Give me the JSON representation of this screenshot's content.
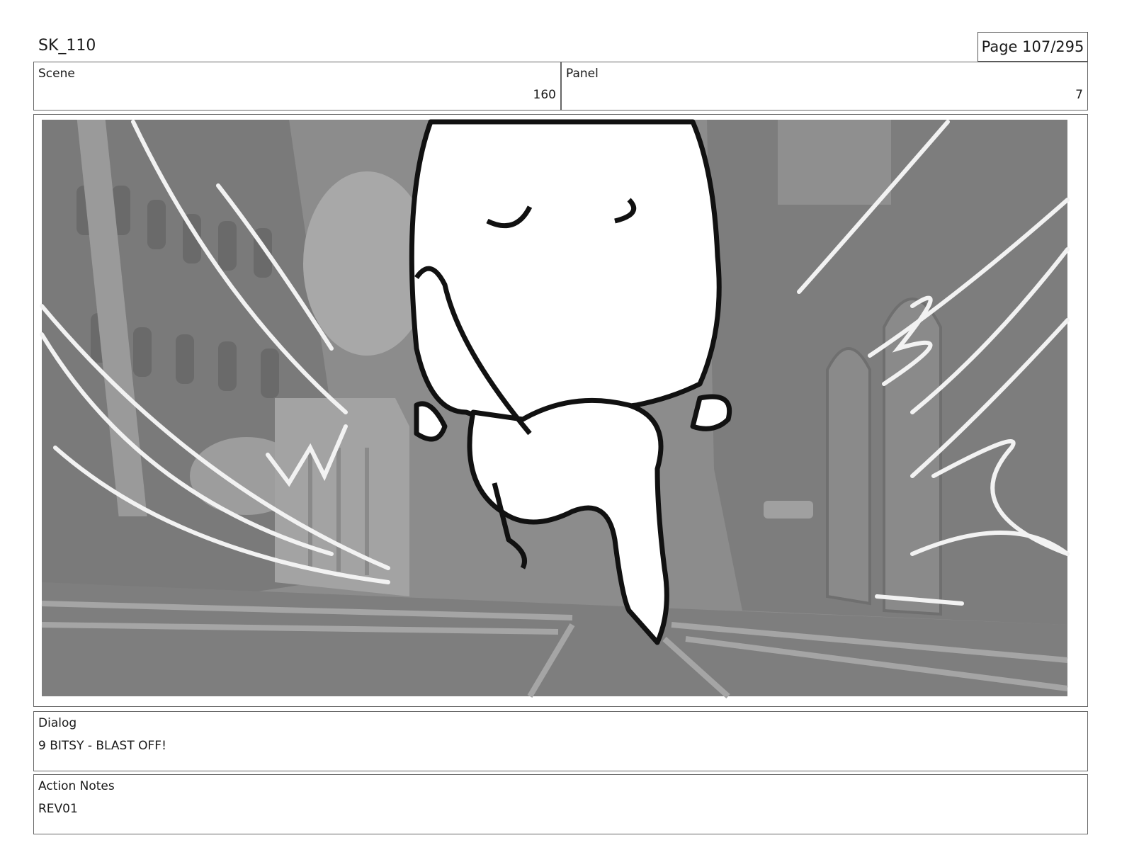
{
  "header": {
    "sequence": "SK_110",
    "page": "Page 107/295"
  },
  "scene": {
    "label": "Scene",
    "value": "160"
  },
  "panel": {
    "label": "Panel",
    "value": "7"
  },
  "dialog": {
    "label": "Dialog",
    "text": "9 BITSY - BLAST OFF!"
  },
  "action_notes": {
    "label": "Action Notes",
    "text": "REV01"
  }
}
